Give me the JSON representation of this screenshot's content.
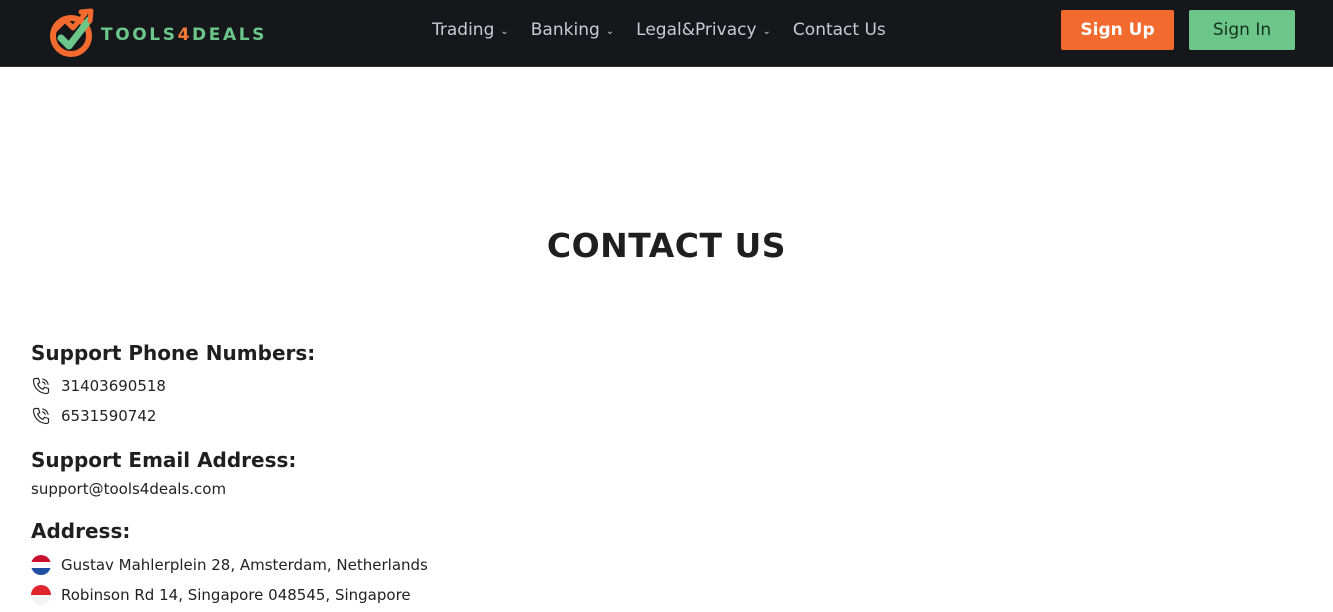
{
  "brand": {
    "name_part1": "TOOLS",
    "name_part2": "4",
    "name_part3": "DEALS",
    "accent_orange": "#f26a2d",
    "accent_green": "#6cc68a",
    "nav_bg": "#15171b"
  },
  "nav": {
    "items": [
      {
        "label": "Trading",
        "has_dropdown": true
      },
      {
        "label": "Banking",
        "has_dropdown": true
      },
      {
        "label": "Legal&Privacy",
        "has_dropdown": true
      },
      {
        "label": "Contact Us",
        "has_dropdown": false
      }
    ],
    "chevron_icon": "chevron-down-icon"
  },
  "auth": {
    "signup_label": "Sign Up",
    "signin_label": "Sign In"
  },
  "page": {
    "title": "CONTACT US"
  },
  "support_phone": {
    "heading": "Support Phone Numbers:",
    "numbers": [
      "31403690518",
      "6531590742"
    ],
    "icon": "phone-icon"
  },
  "support_email": {
    "heading": "Support Email Address:",
    "email": "support@tools4deals.com"
  },
  "address": {
    "heading": "Address:",
    "locations": [
      {
        "text": "Gustav Mahlerplein 28, Amsterdam, Netherlands",
        "flag_icon": "netherlands-flag-icon"
      },
      {
        "text": "Robinson Rd 14, Singapore 048545, Singapore",
        "flag_icon": "singapore-flag-icon"
      }
    ]
  }
}
